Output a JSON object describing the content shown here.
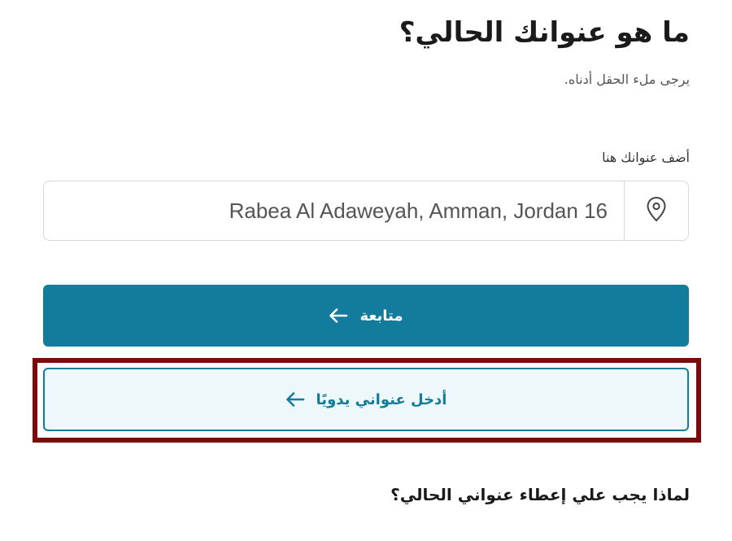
{
  "header": {
    "title": "ما هو عنوانك الحالي؟",
    "subtitle": "يرجى ملء الحقل أدناه."
  },
  "address_field": {
    "label": "أضف عنوانك هنا",
    "value": "Rabea Al Adaweyah, Amman, Jordan 16",
    "icon": "location-pin-icon"
  },
  "buttons": {
    "continue_label": "متابعة",
    "manual_entry_label": "أدخل عنواني يدويًا",
    "arrow_icon": "arrow-left-icon"
  },
  "faq": {
    "heading": "لماذا يجب علي إعطاء عنواني الحالي؟"
  },
  "colors": {
    "primary": "#137b9b",
    "secondary_bg": "#eef8fb",
    "highlight_border": "#7a0c0c"
  }
}
